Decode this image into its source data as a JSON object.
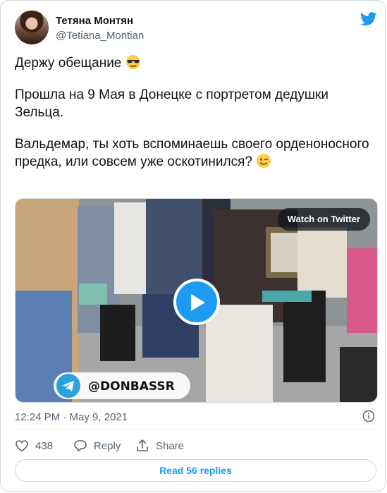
{
  "tweet": {
    "author_name": "Тетяна Монтян",
    "author_handle": "@Tetiana_Montian",
    "paragraphs": [
      "Держу обещание",
      "Прошла на 9 Мая в Донецке с портретом дедушки Зельца.",
      "Вальдемар, ты хоть вспоминаешь своего орденоносного предка, или совсем уже оскотинился?"
    ],
    "emoji_1": "sunglasses-emoji",
    "emoji_2": "winking-face-emoji",
    "timestamp": "12:24 PM · May 9, 2021"
  },
  "media": {
    "watch_label": "Watch on Twitter",
    "watermark": "@DONBASSR"
  },
  "actions": {
    "likes": "438",
    "reply_label": "Reply",
    "share_label": "Share"
  },
  "read_replies_label": "Read 56 replies",
  "colors": {
    "accent": "#1d9bf0",
    "text": "#0f1419",
    "secondary": "#536471",
    "border": "#cfd9de"
  }
}
